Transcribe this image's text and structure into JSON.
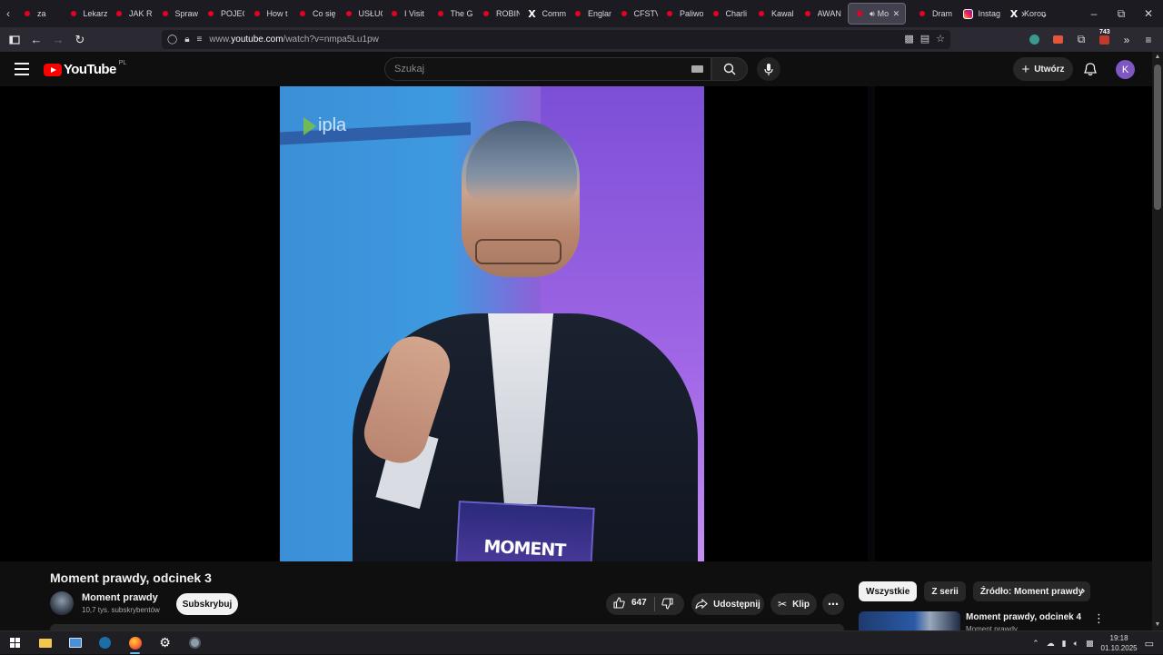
{
  "browser": {
    "tabs": [
      {
        "label": "za",
        "favicon": "yt"
      },
      {
        "label": "Lekarz",
        "favicon": "yt"
      },
      {
        "label": "JAK R",
        "favicon": "yt"
      },
      {
        "label": "Spraw",
        "favicon": "yt"
      },
      {
        "label": "POJEC",
        "favicon": "yt"
      },
      {
        "label": "How t",
        "favicon": "yt"
      },
      {
        "label": "Co się",
        "favicon": "yt"
      },
      {
        "label": "USŁUC",
        "favicon": "yt"
      },
      {
        "label": "I Visit",
        "favicon": "yt"
      },
      {
        "label": "The G",
        "favicon": "yt"
      },
      {
        "label": "ROBIN",
        "favicon": "yt"
      },
      {
        "label": "Comm",
        "favicon": "x"
      },
      {
        "label": "Englan",
        "favicon": "yt"
      },
      {
        "label": "CFSTV",
        "favicon": "yt"
      },
      {
        "label": "Paliwo",
        "favicon": "yt"
      },
      {
        "label": "Charli",
        "favicon": "yt"
      },
      {
        "label": "Kawal",
        "favicon": "yt"
      },
      {
        "label": "AWAN",
        "favicon": "yt"
      },
      {
        "label": "Mo",
        "favicon": "yt",
        "active": true
      },
      {
        "label": "Dram",
        "favicon": "yt"
      },
      {
        "label": "Instag",
        "favicon": "ig"
      },
      {
        "label": "Koron",
        "favicon": "x"
      }
    ],
    "url_prefix": "www.",
    "url_host": "youtube.com",
    "url_path": "/watch?v=nmpa5Lu1pw",
    "notification_count": "743"
  },
  "youtube": {
    "logo_text": "YouTube",
    "country_code": "PL",
    "search_placeholder": "Szukaj",
    "create_label": "Utwórz",
    "avatar_letter": "K"
  },
  "video": {
    "watermark": "ipla",
    "card_text": "MOMENT",
    "title": "Moment prawdy, odcinek 3",
    "channel_name": "Moment prawdy",
    "subscribers": "10,7 tys. subskrybentów",
    "subscribe_label": "Subskrybuj",
    "like_count": "647",
    "share_label": "Udostępnij",
    "clip_label": "Klip"
  },
  "sidebar": {
    "chips": [
      "Wszystkie",
      "Z serii",
      "Źródło: Moment prawdy"
    ],
    "recommendation": {
      "title": "Moment prawdy, odcinek 4",
      "channel": "Moment prawdy"
    }
  },
  "taskbar": {
    "time": "19:18",
    "date": "01.10.2025"
  },
  "colors": {
    "yt_red": "#ff0000",
    "avatar_bg": "#7e57c2",
    "page_bg": "#0f0f0f"
  }
}
